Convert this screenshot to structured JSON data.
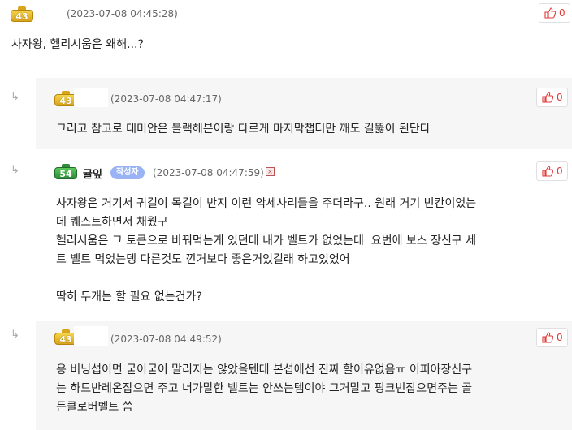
{
  "comments": [
    {
      "level": "43",
      "timestamp": "(2023-07-08 04:45:28)",
      "likes": "0",
      "text": "사자왕, 헬리시움은 왜해...?"
    },
    {
      "reply_arrow": "↳",
      "level": "43",
      "timestamp": "(2023-07-08 04:47:17)",
      "likes": "0",
      "text": "그리고 참고로 데미안은 블랙헤븐이랑 다르게 마지막챕터만 깨도 길뚫이 된단다"
    },
    {
      "reply_arrow": "↳",
      "level": "54",
      "author": "귤잎",
      "author_badge": "작성자",
      "timestamp": "(2023-07-08 04:47:59)",
      "likes": "0",
      "text": "사자왕은 거기서 귀걸이 목걸이 반지 이런 악세사리들을 주더라구.. 원래 거기 빈칸이었는\n데 퀘스트하면서 채웠구\n헬리시움은 그 토큰으로 바꿔먹는게 있던데 내가 벨트가 없었는데  요번에 보스 장신구 세\n트 벨트 먹었는뎅 다른것도 낀거보다 좋은거있길래 하고있었어\n\n딱히 두개는 할 필요 없는건가?"
    },
    {
      "reply_arrow": "↳",
      "level": "43",
      "timestamp": "(2023-07-08 04:49:52)",
      "likes": "0",
      "text": "응 버닝섭이면 굳이굳이 말리지는 않았을텐데 본섭에선 진짜 할이유없음ㅠ 이피아장신구\n는 하드반레온잡으면 주고 너가말한 벨트는 안쓰는템이야 그거말고 핑크빈잡으면주는 골\n든클로버벨트 씀"
    }
  ],
  "colors": {
    "reply_background": "#f6f6f6",
    "like_red": "#e03a3a",
    "author_badge": "#9ab3f5"
  },
  "icons": [
    "level-badge-icon",
    "thumbs-up-icon",
    "reply-arrow-icon",
    "delete-x-icon"
  ]
}
